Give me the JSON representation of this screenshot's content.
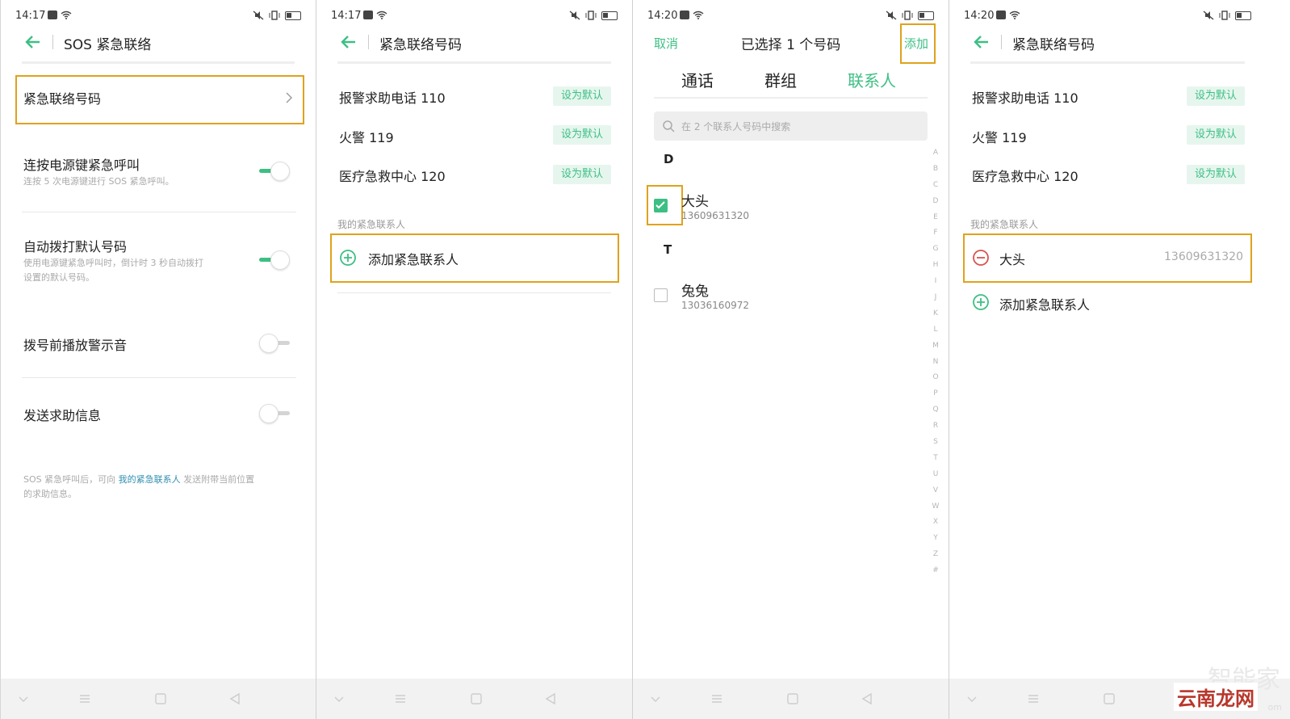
{
  "panel1": {
    "time": "14:17",
    "title": "SOS 紧急联络",
    "item_emergency_numbers": "紧急联络号码",
    "item_power_key": "连按电源键紧急呼叫",
    "item_power_key_desc": "连按 5 次电源键进行 SOS 紧急呼叫。",
    "item_auto_dial": "自动拨打默认号码",
    "item_auto_dial_desc_1": "使用电源键紧急呼叫时，倒计时 3 秒自动拨打",
    "item_auto_dial_desc_2": "设置的默认号码。",
    "item_alarm": "拨号前播放警示音",
    "item_send_msg": "发送求助信息",
    "footer_1": "SOS 紧急呼叫后，可向",
    "footer_link": "我的紧急联系人",
    "footer_2": "发送附带当前位置",
    "footer_3": "的求助信息。"
  },
  "panel2": {
    "time": "14:17",
    "title": "紧急联络号码",
    "numbers": [
      {
        "label": "报警求助电话 110",
        "btn": "设为默认"
      },
      {
        "label": "火警 119",
        "btn": "设为默认"
      },
      {
        "label": "医疗急救中心 120",
        "btn": "设为默认"
      }
    ],
    "section": "我的紧急联系人",
    "add_contact": "添加紧急联系人"
  },
  "panel3": {
    "time": "14:20",
    "cancel": "取消",
    "title": "已选择 1 个号码",
    "add": "添加",
    "tabs": [
      "通话",
      "群组",
      "联系人"
    ],
    "search_placeholder": "在 2 个联系人号码中搜索",
    "groups": [
      {
        "letter": "D",
        "name": "大头",
        "number": "13609631320",
        "checked": true
      },
      {
        "letter": "T",
        "name": "兔兔",
        "number": "13036160972",
        "checked": false
      }
    ],
    "index_letters": [
      "A",
      "B",
      "C",
      "D",
      "E",
      "F",
      "G",
      "H",
      "I",
      "J",
      "K",
      "L",
      "M",
      "N",
      "O",
      "P",
      "Q",
      "R",
      "S",
      "T",
      "U",
      "V",
      "W",
      "X",
      "Y",
      "Z",
      "#"
    ]
  },
  "panel4": {
    "time": "14:20",
    "title": "紧急联络号码",
    "numbers": [
      {
        "label": "报警求助电话 110",
        "btn": "设为默认"
      },
      {
        "label": "火警 119",
        "btn": "设为默认"
      },
      {
        "label": "医疗急救中心 120",
        "btn": "设为默认"
      }
    ],
    "section": "我的紧急联系人",
    "contact_name": "大头",
    "contact_number": "13609631320",
    "add_contact": "添加紧急联系人"
  },
  "watermark": {
    "line1": "智能家",
    "line2": "云南龙网",
    "line3": "om"
  },
  "colors": {
    "accent": "#3dbf84",
    "highlight": "#e0a21c",
    "remove": "#d9534f"
  }
}
